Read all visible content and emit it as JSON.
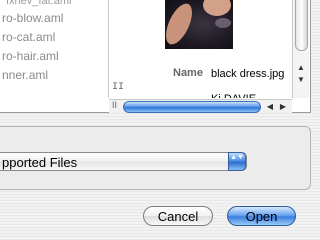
{
  "browser": {
    "column1_items": [
      "ıxnev_ıat.aml",
      "ro-blow.aml",
      "ro-cat.aml",
      "ro-hair.aml",
      "nner.aml"
    ],
    "splitter_glyph": "II",
    "preview": {
      "name_label": "Name",
      "name_value": "black dress.jpg",
      "next_row_partial": "Ki   DAVIE"
    },
    "vscroll": {
      "up_arrow": "▲",
      "down_arrow": "▼"
    },
    "hscroll": {
      "left_arrow": "◀",
      "right_arrow": "▶",
      "splitter_glyph": "II"
    }
  },
  "filter_popup": {
    "selected": "pported Files",
    "stepper_glyph": "▲▼"
  },
  "buttons": {
    "cancel_label": "Cancel",
    "open_label": "Open"
  },
  "colors": {
    "accent_blue": "#3b7ee0",
    "panel_bg": "#ececec"
  }
}
